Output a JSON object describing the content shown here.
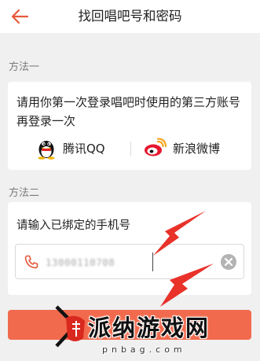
{
  "header": {
    "title": "找回唱吧号和密码"
  },
  "method1": {
    "label": "方法一",
    "description": "请用你第一次登录唱吧时使用的第三方账号再登录一次",
    "options": [
      {
        "label": "腾讯QQ",
        "icon": "qq-icon"
      },
      {
        "label": "新浪微博",
        "icon": "weibo-icon"
      }
    ]
  },
  "method2": {
    "label": "方法二",
    "prompt": "请输入已绑定的手机号",
    "phone_value": "13000110708"
  },
  "colors": {
    "accent": "#f26a4d",
    "back_arrow": "#e8583b",
    "annotation_arrow": "#e8322a"
  },
  "watermark": {
    "text": "派纳游戏网",
    "url": "pnbag.com"
  }
}
